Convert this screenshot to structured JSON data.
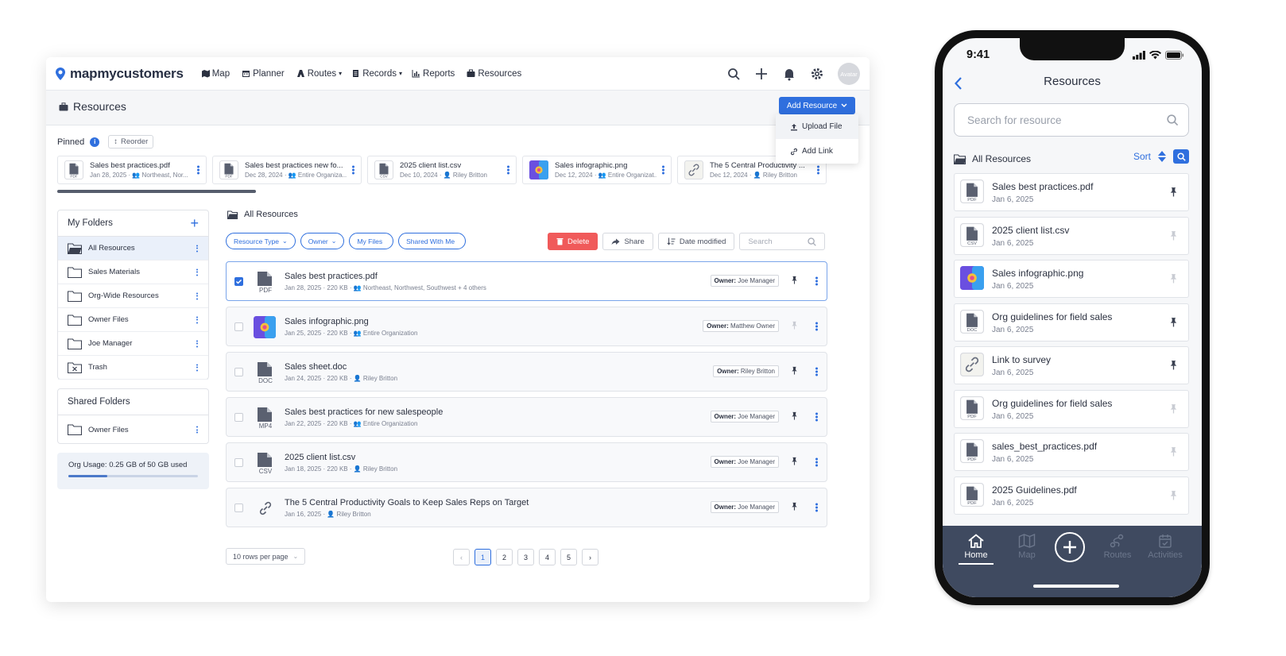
{
  "desktop": {
    "brand": "mapmycustomers",
    "nav": [
      {
        "label": "Map",
        "icon": "map-icon",
        "caret": ""
      },
      {
        "label": "Planner",
        "icon": "calendar-icon",
        "caret": ""
      },
      {
        "label": "Routes",
        "icon": "routes-icon",
        "caret": "▾"
      },
      {
        "label": "Records",
        "icon": "records-icon",
        "caret": "▾"
      },
      {
        "label": "Reports",
        "icon": "reports-icon",
        "caret": ""
      },
      {
        "label": "Resources",
        "icon": "briefcase-icon",
        "caret": ""
      }
    ],
    "avatar": "Avatar",
    "page_title": "Resources",
    "add_resource": "Add Resource",
    "add_menu": [
      "Upload File",
      "Add Link"
    ],
    "pinned_label": "Pinned",
    "reorder_label": "Reorder",
    "pinned": [
      {
        "name": "Sales best practices.pdf",
        "meta": "Jan 28, 2025 · 👥 Northeast, Nor...",
        "type": "PDF"
      },
      {
        "name": "Sales best practices new fo...",
        "meta": "Dec 28, 2024 · 👥 Entire Organiza...",
        "type": "PDF"
      },
      {
        "name": "2025 client list.csv",
        "meta": "Dec 10, 2024 · 👤 Riley Britton",
        "type": "CSV"
      },
      {
        "name": "Sales infographic.png",
        "meta": "Dec 12, 2024 · 👥 Entire Organizat...",
        "type": "IMG"
      },
      {
        "name": "The 5 Central Productivity ...",
        "meta": "Dec 12, 2024 · 👤 Riley Britton",
        "type": "LINK"
      }
    ],
    "my_folders_title": "My Folders",
    "my_folders": [
      "All Resources",
      "Sales Materials",
      "Org-Wide Resources",
      "Owner Files",
      "Joe Manager",
      "Trash"
    ],
    "shared_folders_title": "Shared Folders",
    "shared_folders": [
      "Owner Files"
    ],
    "org_usage": "Org Usage: 0.25 GB of 50 GB used",
    "org_usage_fraction": 0.3,
    "section_title": "All Resources",
    "filters": [
      {
        "label": "Resource Type",
        "caret": "⌄"
      },
      {
        "label": "Owner",
        "caret": "⌄"
      },
      {
        "label": "My Files",
        "caret": ""
      },
      {
        "label": "Shared With Me",
        "caret": ""
      }
    ],
    "delete_label": "Delete",
    "share_label": "Share",
    "sort_label": "Date modified",
    "search_placeholder": "Search",
    "owner_prefix": "Owner:",
    "rows": [
      {
        "name": "Sales best practices.pdf",
        "meta": "Jan 28, 2025 · 220 KB · 👥 Northeast, Northwest, Southwest + 4 others",
        "owner": "Joe Manager",
        "type": "PDF",
        "checked": true,
        "pinned": true
      },
      {
        "name": "Sales infographic.png",
        "meta": "Jan 25, 2025 · 220 KB · 👥 Entire Organization",
        "owner": "Matthew Owner",
        "type": "IMG",
        "checked": false,
        "pinned": false
      },
      {
        "name": "Sales sheet.doc",
        "meta": "Jan 24, 2025 · 220 KB · 👤 Riley Britton",
        "owner": "Riley Britton",
        "type": "DOC",
        "checked": false,
        "pinned": true
      },
      {
        "name": "Sales best practices for new salespeople",
        "meta": "Jan 22, 2025 · 220 KB · 👥 Entire Organization",
        "owner": "Joe Manager",
        "type": "MP4",
        "checked": false,
        "pinned": true
      },
      {
        "name": "2025 client list.csv",
        "meta": "Jan 18, 2025 · 220 KB · 👤 Riley Britton",
        "owner": "Joe Manager",
        "type": "CSV",
        "checked": false,
        "pinned": true
      },
      {
        "name": "The 5 Central Productivity Goals to Keep Sales Reps on Target",
        "meta": "Jan 16, 2025 · 👤 Riley Britton",
        "owner": "Joe Manager",
        "type": "LINK",
        "checked": false,
        "pinned": true
      }
    ],
    "rows_per_page": "10 rows per page",
    "pages": [
      "1",
      "2",
      "3",
      "4",
      "5"
    ],
    "current_page": "1",
    "prev": "‹",
    "next": "›"
  },
  "mobile": {
    "time": "9:41",
    "title": "Resources",
    "search_placeholder": "Search for resource",
    "all_resources": "All Resources",
    "sort_label": "Sort",
    "items": [
      {
        "name": "Sales best practices.pdf",
        "date": "Jan 6, 2025",
        "type": "PDF",
        "pinned": true
      },
      {
        "name": "2025 client list.csv",
        "date": "Jan 6, 2025",
        "type": "CSV",
        "pinned": false
      },
      {
        "name": "Sales infographic.png",
        "date": "Jan 6, 2025",
        "type": "IMG",
        "pinned": false
      },
      {
        "name": "Org guidelines for field sales",
        "date": "Jan 6, 2025",
        "type": "DOC",
        "pinned": true
      },
      {
        "name": "Link to survey",
        "date": "Jan 6, 2025",
        "type": "LINK",
        "pinned": true
      },
      {
        "name": "Org guidelines for field sales",
        "date": "Jan 6, 2025",
        "type": "PDF",
        "pinned": false
      },
      {
        "name": "sales_best_practices.pdf",
        "date": "Jan 6, 2025",
        "type": "PDF",
        "pinned": false
      },
      {
        "name": "2025 Guidelines.pdf",
        "date": "Jan 6, 2025",
        "type": "PDF",
        "pinned": false
      }
    ],
    "tabs": [
      "Home",
      "Map",
      "Routes",
      "Activities"
    ],
    "active_tab": "Home"
  },
  "colors": {
    "accent": "#2f6fde",
    "danger": "#f05a5a",
    "tabbar": "#3f4a60"
  }
}
